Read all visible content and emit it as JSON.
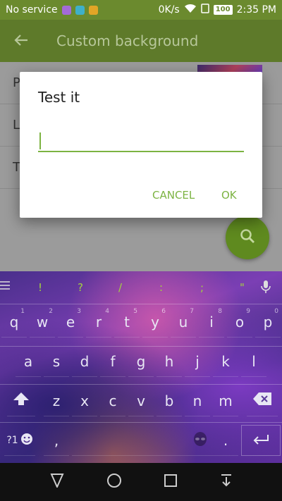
{
  "status_bar": {
    "carrier": "No service",
    "speed": "0K/s",
    "battery": "100",
    "time": "2:35 PM",
    "app_icon_colors": [
      "#a36bd6",
      "#3fb0c8",
      "#e2a526"
    ]
  },
  "app_bar": {
    "title": "Custom background",
    "back_icon": "arrow-left-icon"
  },
  "list": {
    "rows": [
      {
        "label": "P"
      },
      {
        "label": "L"
      },
      {
        "label": "T"
      }
    ]
  },
  "dialog": {
    "title": "Test it",
    "input_value": "",
    "cancel_label": "CANCEL",
    "ok_label": "OK",
    "accent": "#7cb342"
  },
  "fab": {
    "icon": "search-icon"
  },
  "keyboard": {
    "toolbar_symbols": [
      "!",
      "?",
      "/",
      ":",
      ";",
      "\""
    ],
    "rows": [
      [
        "q",
        "w",
        "e",
        "r",
        "t",
        "y",
        "u",
        "i",
        "o",
        "p"
      ],
      [
        "a",
        "s",
        "d",
        "f",
        "g",
        "h",
        "j",
        "k",
        "l"
      ],
      [
        "z",
        "x",
        "c",
        "v",
        "b",
        "n",
        "m"
      ]
    ],
    "hints": {
      "q": "1",
      "w": "2",
      "e": "3",
      "r": "4",
      "t": "5",
      "y": "6",
      "u": "7",
      "i": "8",
      "o": "9",
      "p": "0"
    },
    "bottom": {
      "sym_label": "?1",
      "comma": ",",
      "period": "."
    }
  },
  "nav_bar": {
    "buttons": [
      "back-triangle-icon",
      "home-circle-icon",
      "recents-square-icon",
      "notifications-down-icon"
    ]
  }
}
